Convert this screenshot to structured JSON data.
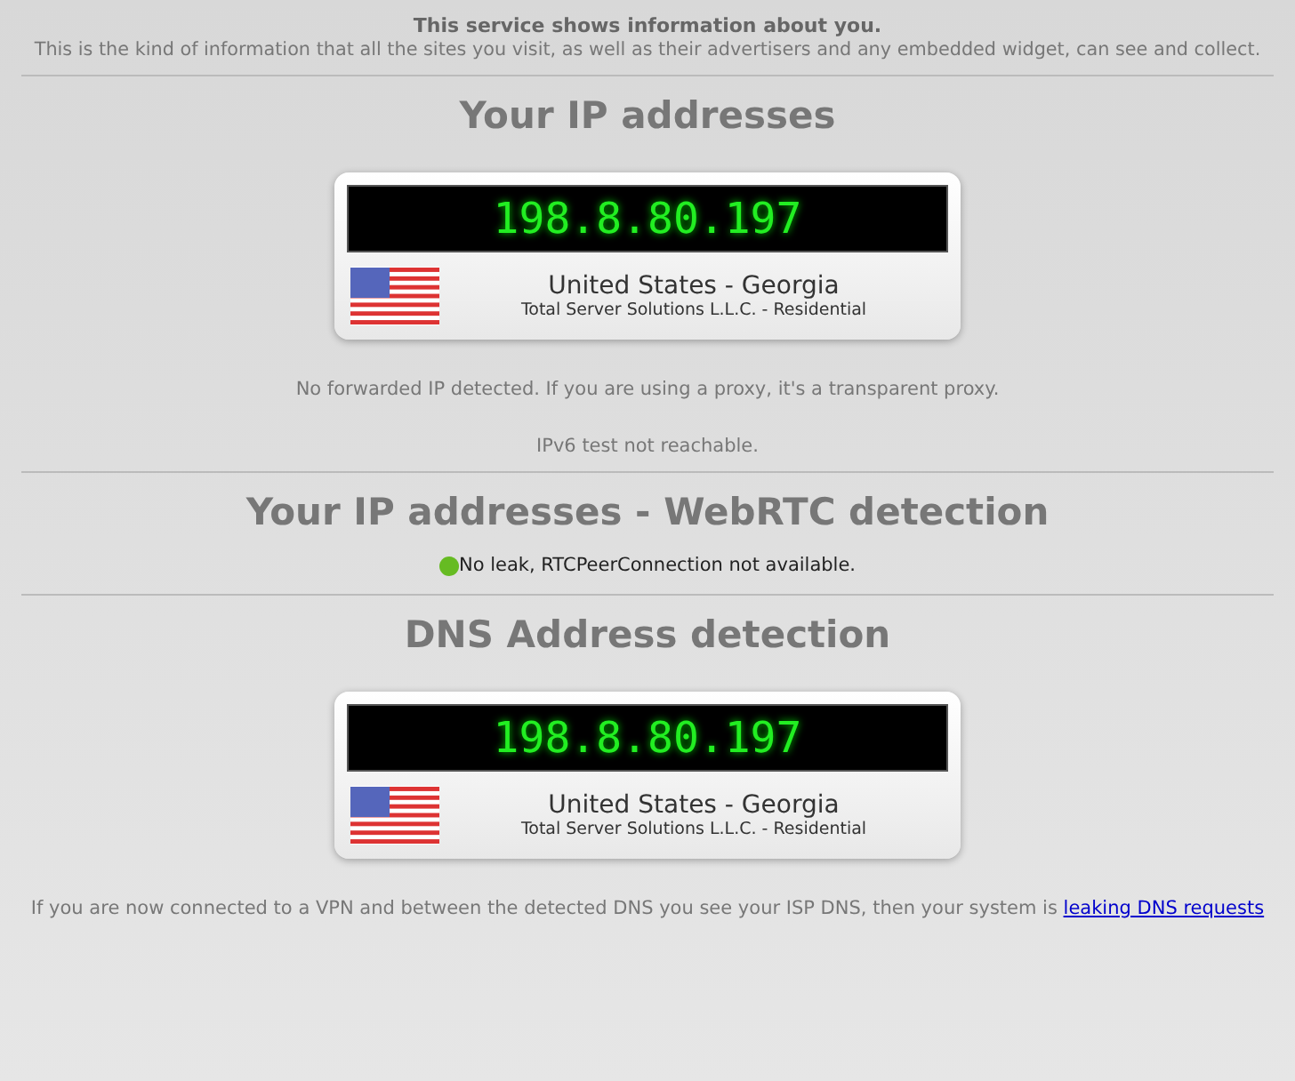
{
  "header": {
    "title": "This service shows information about you.",
    "subtitle": "This is the kind of information that all the sites you visit, as well as their advertisers and any embedded widget, can see and collect."
  },
  "sections": [
    {
      "heading": "Your IP addresses",
      "cards": [
        {
          "ip": "198.8.80.197",
          "location": "United States - Georgia",
          "isp": "Total Server Solutions L.L.C. - Residential"
        }
      ],
      "notes": [
        "No forwarded IP detected. If you are using a proxy, it's a transparent proxy.",
        "IPv6 test not reachable."
      ]
    },
    {
      "heading": "Your IP addresses - WebRTC detection",
      "status": {
        "text": "No leak, RTCPeerConnection not available.",
        "color": "#66bb22"
      }
    },
    {
      "heading": "DNS Address detection",
      "cards": [
        {
          "ip": "198.8.80.197",
          "location": "United States - Georgia",
          "isp": "Total Server Solutions L.L.C. - Residential"
        }
      ],
      "footer": {
        "text": "If you are now connected to a VPN and between the detected DNS you see your ISP DNS, then your system is",
        "link": "leaking DNS requests"
      }
    }
  ]
}
